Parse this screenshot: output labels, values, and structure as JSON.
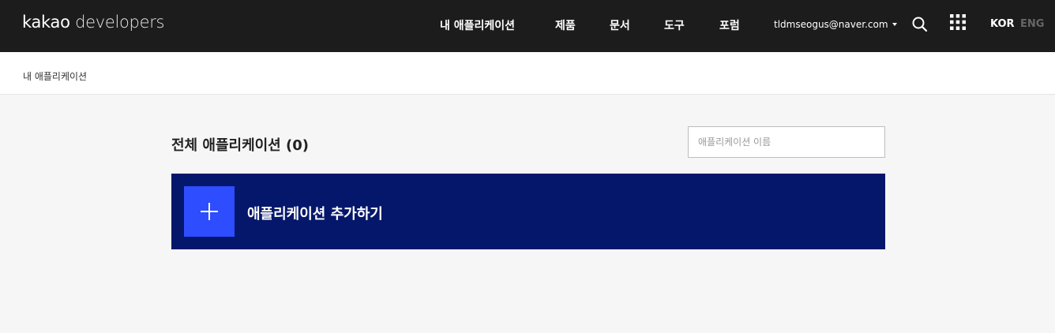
{
  "header": {
    "logo_brand": "kakao",
    "logo_product": "developers",
    "nav": [
      {
        "label": "내 애플리케이션"
      },
      {
        "label": "제품"
      },
      {
        "label": "문서"
      },
      {
        "label": "도구"
      },
      {
        "label": "포럼"
      }
    ],
    "account_email": "tldmseogus@naver.com",
    "lang_active": "KOR",
    "lang_inactive": "ENG"
  },
  "breadcrumb": "내 애플리케이션",
  "main": {
    "title": "전체 애플리케이션 (0)",
    "search_placeholder": "애플리케이션 이름",
    "add_label": "애플리케이션 추가하기"
  },
  "colors": {
    "header_bg": "#1c1c1c",
    "add_panel_bg": "#05176a",
    "plus_box_bg": "#2e4dff",
    "page_bg": "#f5f6f5"
  },
  "icons": [
    "search-icon",
    "apps-grid-icon",
    "plus-icon",
    "caret-down-icon"
  ]
}
